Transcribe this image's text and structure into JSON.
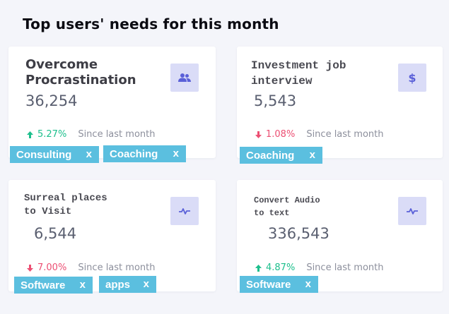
{
  "page": {
    "title": "Top users' needs for this month"
  },
  "stats_label": "Since last month",
  "cards": [
    {
      "title": "Overcome\nProcrastination",
      "value": "36,254",
      "icon": "users-icon",
      "trend": "up",
      "change": "5.27%",
      "tags": [
        {
          "label": "Consulting",
          "remove": "x"
        },
        {
          "label": "Coaching",
          "remove": "x"
        }
      ]
    },
    {
      "title": "Investment job\ninterview",
      "value": "5,543",
      "icon": "dollar-icon",
      "trend": "down",
      "change": "1.08%",
      "tags": [
        {
          "label": "Coaching",
          "remove": "x"
        }
      ]
    },
    {
      "title": "Surreal places\nto Visit",
      "value": "6,544",
      "icon": "pulse-icon",
      "trend": "down",
      "change": "7.00%",
      "tags": [
        {
          "label": "Software",
          "remove": "x"
        },
        {
          "label": "apps",
          "remove": "x"
        }
      ]
    },
    {
      "title": "Convert Audio\nto text",
      "value": "336,543",
      "icon": "pulse-icon",
      "trend": "up",
      "change": "4.87%",
      "tags": [
        {
          "label": "Software",
          "remove": "x"
        }
      ]
    }
  ],
  "colors": {
    "accent_icon": "#5a60d8",
    "icon_bg": "#dadcf7",
    "tag_bg": "#5bbfdf",
    "up": "#1cbf8c",
    "down": "#ec4f73"
  }
}
